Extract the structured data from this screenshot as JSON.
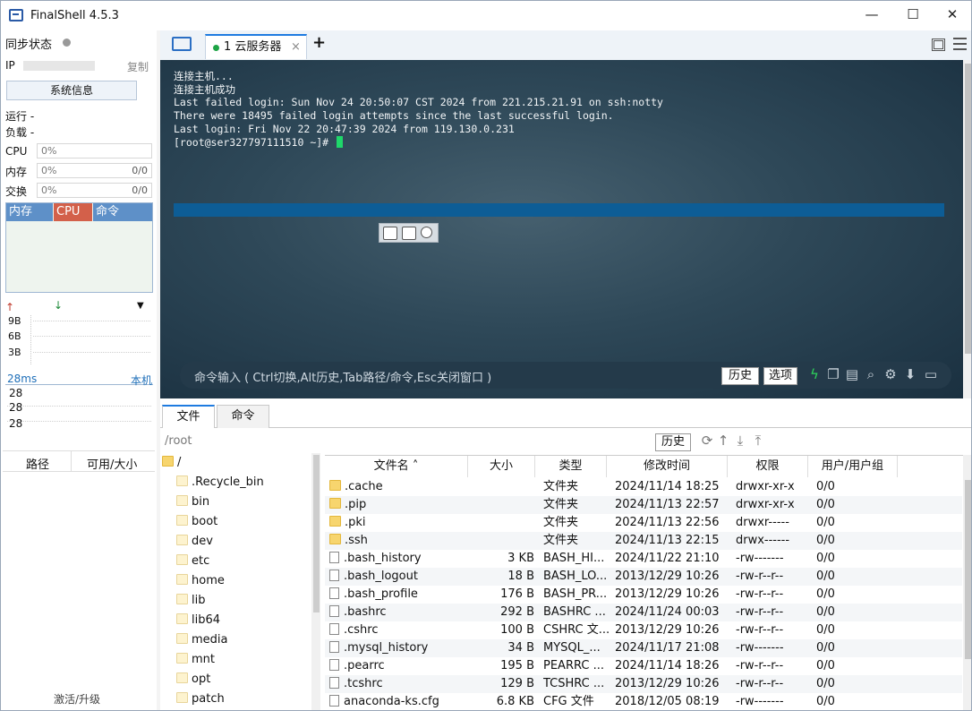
{
  "window": {
    "title": "FinalShell 4.5.3",
    "min": "—",
    "max": "☐",
    "close": "✕"
  },
  "left": {
    "sync_label": "同步状态",
    "ip_label": "IP",
    "copy_label": "复制",
    "sysinfo_button": "系统信息",
    "run_label": "运行 -",
    "load_label": "负载 -",
    "cpu": {
      "label": "CPU",
      "value": "0%"
    },
    "mem": {
      "label": "内存",
      "value": "0%",
      "ratio": "0/0"
    },
    "swap": {
      "label": "交换",
      "value": "0%",
      "ratio": "0/0"
    },
    "proc_tabs": [
      "内存",
      "CPU",
      "命令"
    ],
    "net_scale": [
      "9B",
      "6B",
      "3B"
    ],
    "ping_label": "28ms",
    "ping_host": "本机",
    "ping_values": [
      "28",
      "28",
      "28"
    ],
    "path_header": "路径",
    "avail_header": "可用/大小",
    "upgrade": "激活/升级"
  },
  "tabs": {
    "session_label": "1 云服务器",
    "close": "×",
    "add": "+"
  },
  "terminal": {
    "lines": [
      "连接主机...",
      "连接主机成功",
      "Last failed login: Sun Nov 24 20:50:07 CST 2024 from 221.215.21.91 on ssh:notty",
      "There were 18495 failed login attempts since the last successful login.",
      "Last login: Fri Nov 22 20:47:39 2024 from 119.130.0.231",
      "[root@ser327797111510 ~]# "
    ],
    "cmd_hint": "命令输入 ( Ctrl切换,Alt历史,Tab路径/命令,Esc关闭窗口 )",
    "history_btn": "历史",
    "options_btn": "选项"
  },
  "bottom": {
    "tab_files": "文件",
    "tab_cmds": "命令",
    "path": "/root",
    "history_btn": "历史",
    "tree": [
      ".Recycle_bin",
      "bin",
      "boot",
      "dev",
      "etc",
      "home",
      "lib",
      "lib64",
      "media",
      "mnt",
      "opt",
      "patch"
    ],
    "tree_root": "/",
    "columns": [
      "文件名",
      "大小",
      "类型",
      "修改时间",
      "权限",
      "用户/用户组"
    ],
    "files": [
      {
        "name": ".cache",
        "size": "",
        "type": "文件夹",
        "mtime": "2024/11/14 18:25",
        "perm": "drwxr-xr-x",
        "owner": "0/0",
        "dir": true
      },
      {
        "name": ".pip",
        "size": "",
        "type": "文件夹",
        "mtime": "2024/11/13 22:57",
        "perm": "drwxr-xr-x",
        "owner": "0/0",
        "dir": true
      },
      {
        "name": ".pki",
        "size": "",
        "type": "文件夹",
        "mtime": "2024/11/13 22:56",
        "perm": "drwxr-----",
        "owner": "0/0",
        "dir": true
      },
      {
        "name": ".ssh",
        "size": "",
        "type": "文件夹",
        "mtime": "2024/11/13 22:15",
        "perm": "drwx------",
        "owner": "0/0",
        "dir": true
      },
      {
        "name": ".bash_history",
        "size": "3 KB",
        "type": "BASH_HI...",
        "mtime": "2024/11/22 21:10",
        "perm": "-rw-------",
        "owner": "0/0",
        "dir": false
      },
      {
        "name": ".bash_logout",
        "size": "18 B",
        "type": "BASH_LO...",
        "mtime": "2013/12/29 10:26",
        "perm": "-rw-r--r--",
        "owner": "0/0",
        "dir": false
      },
      {
        "name": ".bash_profile",
        "size": "176 B",
        "type": "BASH_PR...",
        "mtime": "2013/12/29 10:26",
        "perm": "-rw-r--r--",
        "owner": "0/0",
        "dir": false
      },
      {
        "name": ".bashrc",
        "size": "292 B",
        "type": "BASHRC ...",
        "mtime": "2024/11/24 00:03",
        "perm": "-rw-r--r--",
        "owner": "0/0",
        "dir": false
      },
      {
        "name": ".cshrc",
        "size": "100 B",
        "type": "CSHRC 文...",
        "mtime": "2013/12/29 10:26",
        "perm": "-rw-r--r--",
        "owner": "0/0",
        "dir": false
      },
      {
        "name": ".mysql_history",
        "size": "34 B",
        "type": "MYSQL_...",
        "mtime": "2024/11/17 21:08",
        "perm": "-rw-------",
        "owner": "0/0",
        "dir": false
      },
      {
        "name": ".pearrc",
        "size": "195 B",
        "type": "PEARRC ...",
        "mtime": "2024/11/14 18:26",
        "perm": "-rw-r--r--",
        "owner": "0/0",
        "dir": false
      },
      {
        "name": ".tcshrc",
        "size": "129 B",
        "type": "TCSHRC ...",
        "mtime": "2013/12/29 10:26",
        "perm": "-rw-r--r--",
        "owner": "0/0",
        "dir": false
      },
      {
        "name": "anaconda-ks.cfg",
        "size": "6.8 KB",
        "type": "CFG 文件",
        "mtime": "2018/12/05 08:19",
        "perm": "-rw-------",
        "owner": "0/0",
        "dir": false
      }
    ]
  }
}
